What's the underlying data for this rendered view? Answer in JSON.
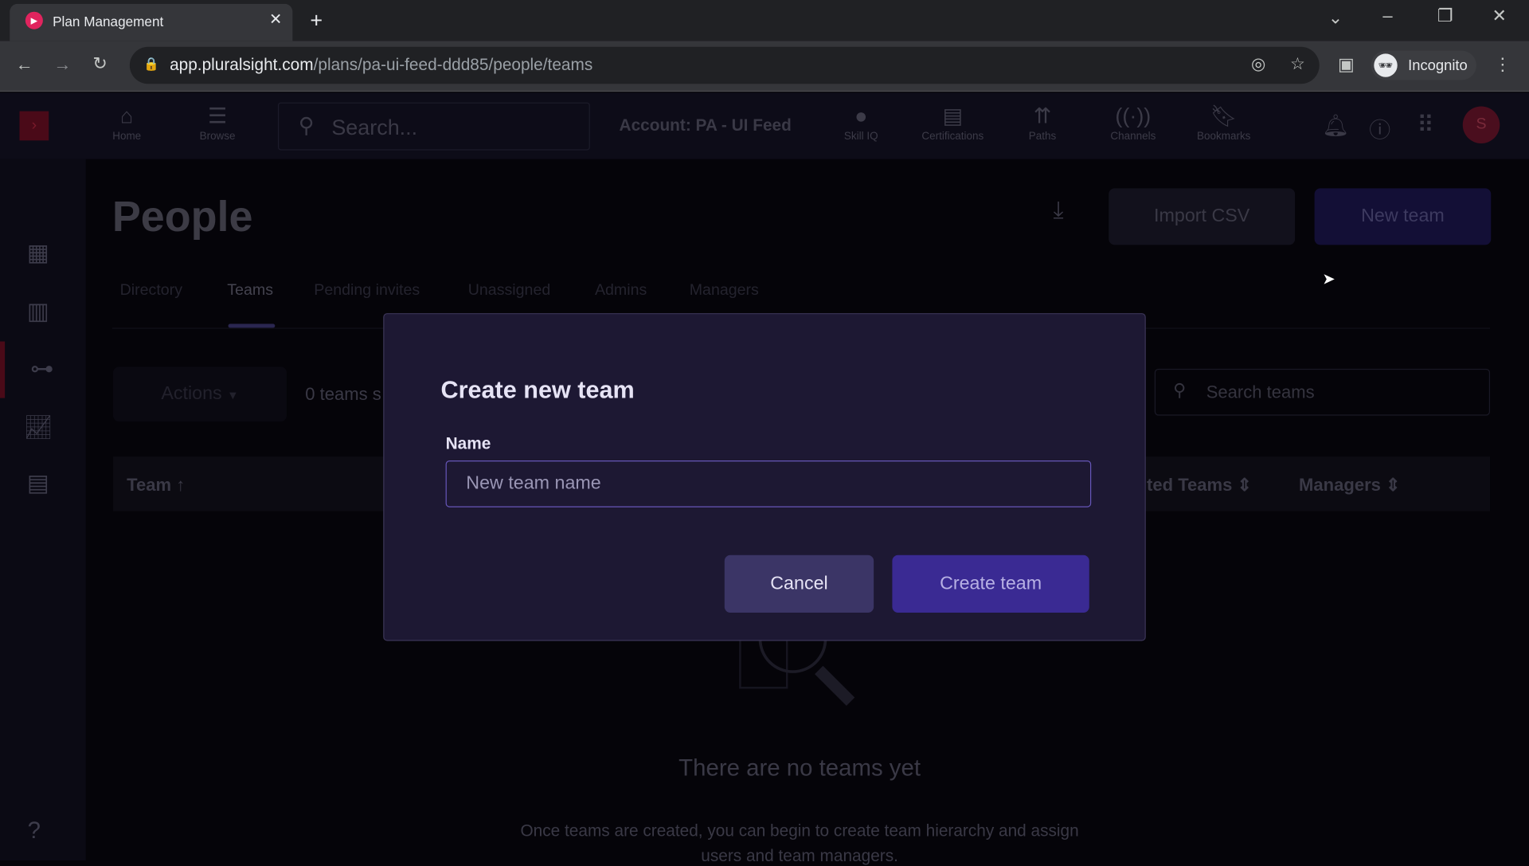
{
  "browser": {
    "tab_title": "Plan Management",
    "url_host": "app.pluralsight.com",
    "url_path": "/plans/pa-ui-feed-ddd85/people/teams",
    "profile": "Incognito"
  },
  "header": {
    "nav": [
      {
        "label": "Home",
        "icon": "home-icon"
      },
      {
        "label": "Browse",
        "icon": "browse-icon"
      }
    ],
    "search_placeholder": "Search...",
    "account": "Account: PA - UI Feed",
    "nav_right": [
      {
        "label": "Skill IQ"
      },
      {
        "label": "Certifications"
      },
      {
        "label": "Paths"
      },
      {
        "label": "Channels"
      },
      {
        "label": "Bookmarks"
      }
    ],
    "avatar": "S"
  },
  "page": {
    "title": "People",
    "import_csv": "Import CSV",
    "new_team": "New team",
    "tabs": [
      "Directory",
      "Teams",
      "Pending invites",
      "Unassigned",
      "Admins",
      "Managers"
    ],
    "active_tab": "Teams",
    "actions": "Actions",
    "count": "0 teams s",
    "search_teams_placeholder": "Search teams",
    "columns": {
      "team": "Team ↑",
      "nested": "ted Teams ⇕",
      "managers": "Managers ⇕"
    },
    "empty_title": "There are no teams yet",
    "empty_desc": "Once teams are created, you can begin to create team hierarchy and assign",
    "empty_desc2": "users and team managers."
  },
  "modal": {
    "title": "Create new team",
    "name_label": "Name",
    "name_placeholder": "New team name",
    "name_value": "",
    "cancel": "Cancel",
    "create": "Create team"
  },
  "colors": {
    "accent": "#3d2a8f",
    "brand": "#e0003c",
    "modal_bg": "#1d1833"
  }
}
